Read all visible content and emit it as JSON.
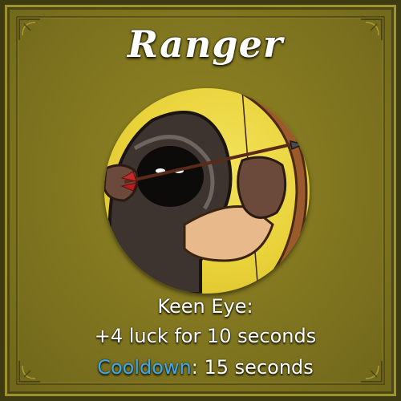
{
  "card": {
    "title": "Ranger",
    "portrait_icon": "hooded-archer-icon",
    "ability": {
      "name": "Keen Eye:",
      "description": "+4 luck for 10 seconds"
    },
    "cooldown": {
      "label": "Cooldown",
      "separator": ":",
      "value": " 15 seconds"
    }
  },
  "colors": {
    "panel": "#857a20",
    "title_text": "#ffffff",
    "body_text": "#ffffff",
    "cooldown_label": "#3ea8e8",
    "portrait_bg": "#e9d23a"
  }
}
